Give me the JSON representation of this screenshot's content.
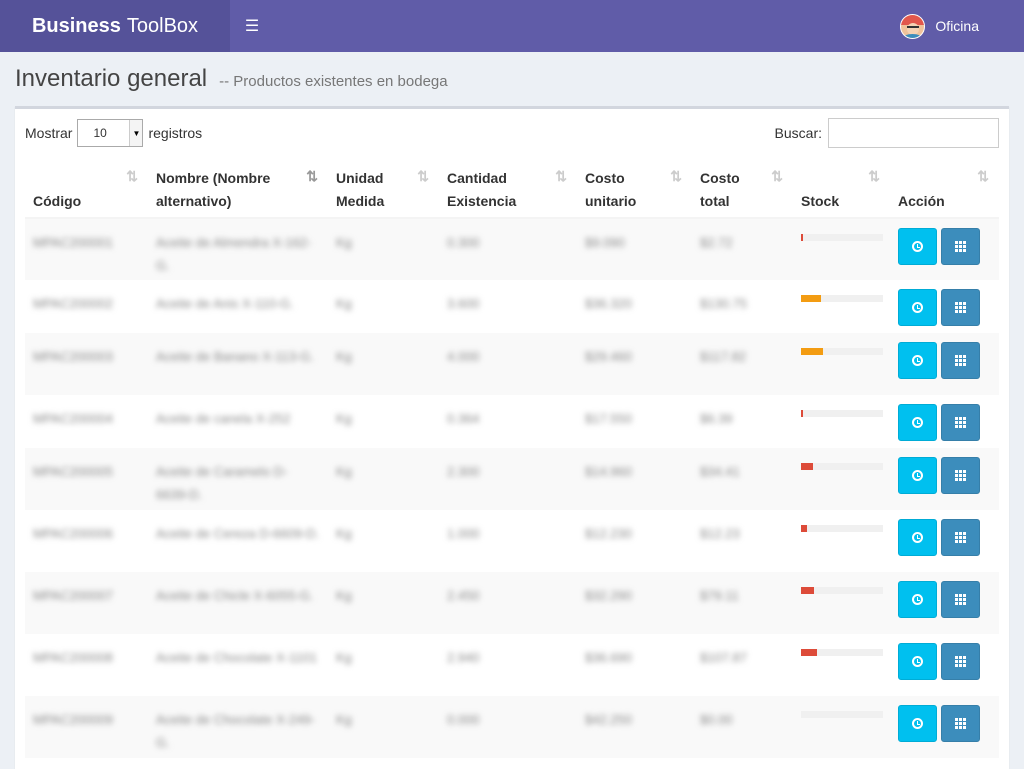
{
  "header": {
    "brand_bold": "Business",
    "brand_rest": "ToolBox",
    "menu_icon": "hamburger-icon",
    "user_name": "Oficina"
  },
  "page": {
    "title": "Inventario general",
    "subtitle": "-- Productos existentes en bodega"
  },
  "table_controls": {
    "show_label": "Mostrar",
    "page_size": "10",
    "records_label": "registros",
    "search_label": "Buscar:",
    "search_value": ""
  },
  "columns": [
    {
      "label": "Código",
      "sort_icon": "sort-icon"
    },
    {
      "label": "Nombre (Nombre alternativo)",
      "sort_icon": "sort-desc-icon"
    },
    {
      "label": "Unidad Medida",
      "sort_icon": "sort-icon"
    },
    {
      "label": "Cantidad Existencia",
      "sort_icon": "sort-icon"
    },
    {
      "label": "Costo unitario",
      "sort_icon": "sort-icon"
    },
    {
      "label": "Costo total",
      "sort_icon": "sort-icon"
    },
    {
      "label": "Stock",
      "sort_icon": "sort-icon"
    },
    {
      "label": "Acción",
      "sort_icon": "sort-icon"
    }
  ],
  "rows": [
    {
      "code": "MPAC200001",
      "name": "Aceite de Almendra X-162-G.",
      "unit": "Kg",
      "qty": "0.300",
      "unit_cost": "$9.090",
      "total_cost": "$2.72",
      "stock_pct": 2,
      "stock_color": "red"
    },
    {
      "code": "MPAC200002",
      "name": "Aceite de Anis X-110-G.",
      "unit": "Kg",
      "qty": "3.600",
      "unit_cost": "$36.320",
      "total_cost": "$130.75",
      "stock_pct": 24,
      "stock_color": "yellow"
    },
    {
      "code": "MPAC200003",
      "name": "Aceite de Banano X-113-G.",
      "unit": "Kg",
      "qty": "4.000",
      "unit_cost": "$29.460",
      "total_cost": "$117.82",
      "stock_pct": 27,
      "stock_color": "yellow"
    },
    {
      "code": "MPAC200004",
      "name": "Aceite de canela X-252",
      "unit": "Kg",
      "qty": "0.364",
      "unit_cost": "$17.550",
      "total_cost": "$6.39",
      "stock_pct": 2,
      "stock_color": "red"
    },
    {
      "code": "MPAC200005",
      "name": "Aceite de Caramelo D-6639-D.",
      "unit": "Kg",
      "qty": "2.300",
      "unit_cost": "$14.960",
      "total_cost": "$34.41",
      "stock_pct": 15,
      "stock_color": "red"
    },
    {
      "code": "MPAC200006",
      "name": "Aceite de Cereza D-6609-D.",
      "unit": "Kg",
      "qty": "1.000",
      "unit_cost": "$12.230",
      "total_cost": "$12.23",
      "stock_pct": 7,
      "stock_color": "red"
    },
    {
      "code": "MPAC200007",
      "name": "Aceite de Chicle X-6055-G.",
      "unit": "Kg",
      "qty": "2.450",
      "unit_cost": "$32.290",
      "total_cost": "$79.11",
      "stock_pct": 16,
      "stock_color": "red"
    },
    {
      "code": "MPAC200008",
      "name": "Aceite de Chocolate X-1101",
      "unit": "Kg",
      "qty": "2.940",
      "unit_cost": "$36.690",
      "total_cost": "$107.87",
      "stock_pct": 20,
      "stock_color": "red"
    },
    {
      "code": "MPAC200009",
      "name": "Aceite de Chocolate X-249-G.",
      "unit": "Kg",
      "qty": "0.000",
      "unit_cost": "$42.250",
      "total_cost": "$0.00",
      "stock_pct": 0,
      "stock_color": "red"
    }
  ],
  "row_actions": {
    "history_icon": "clock-icon",
    "detail_icon": "grid-icon"
  }
}
